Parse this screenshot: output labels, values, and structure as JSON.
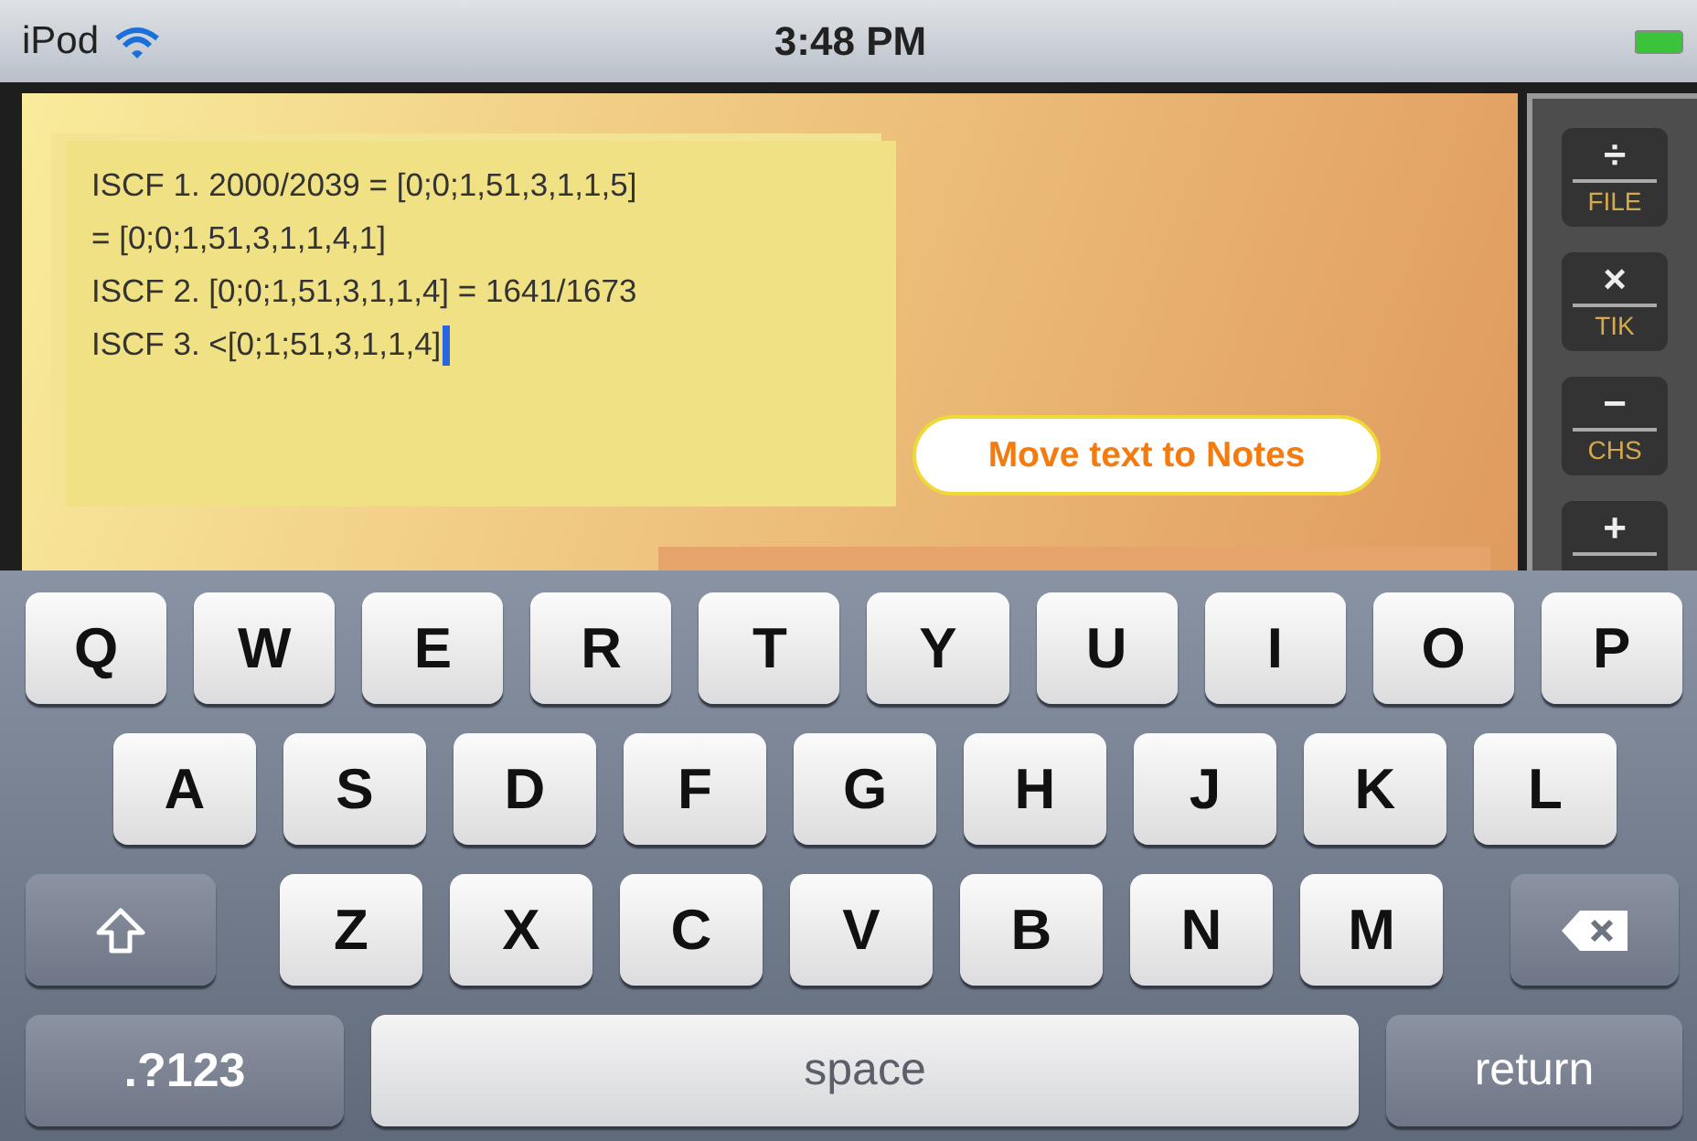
{
  "status_bar": {
    "carrier": "iPod",
    "time": "3:48 PM"
  },
  "note": {
    "lines": [
      "ISCF 1. 2000/2039 = [0;0;1,51,3,1,1,5]",
      "= [0;0;1,51,3,1,1,4,1]",
      "ISCF 2. [0;0;1,51,3,1,1,4] = 1641/1673",
      "ISCF 3. <[0;1;51,3,1,1,4]"
    ]
  },
  "move_button": {
    "label": "Move text to Notes"
  },
  "calc_keys": [
    {
      "symbol": "÷",
      "label": "FILE"
    },
    {
      "symbol": "×",
      "label": "TIK"
    },
    {
      "symbol": "−",
      "label": "CHS"
    },
    {
      "symbol": "+"
    }
  ],
  "keyboard": {
    "rows": [
      [
        {
          "kind": "letter",
          "label": "Q"
        },
        {
          "kind": "letter",
          "label": "W"
        },
        {
          "kind": "letter",
          "label": "E"
        },
        {
          "kind": "letter",
          "label": "R"
        },
        {
          "kind": "letter",
          "label": "T"
        },
        {
          "kind": "letter",
          "label": "Y"
        },
        {
          "kind": "letter",
          "label": "U"
        },
        {
          "kind": "letter",
          "label": "I"
        },
        {
          "kind": "letter",
          "label": "O"
        },
        {
          "kind": "letter",
          "label": "P"
        }
      ],
      [
        {
          "kind": "letter",
          "label": "A"
        },
        {
          "kind": "letter",
          "label": "S"
        },
        {
          "kind": "letter",
          "label": "D"
        },
        {
          "kind": "letter",
          "label": "F"
        },
        {
          "kind": "letter",
          "label": "G"
        },
        {
          "kind": "letter",
          "label": "H"
        },
        {
          "kind": "letter",
          "label": "J"
        },
        {
          "kind": "letter",
          "label": "K"
        },
        {
          "kind": "letter",
          "label": "L"
        }
      ],
      [
        {
          "kind": "shift"
        },
        {
          "kind": "letter",
          "label": "Z"
        },
        {
          "kind": "letter",
          "label": "X"
        },
        {
          "kind": "letter",
          "label": "C"
        },
        {
          "kind": "letter",
          "label": "V"
        },
        {
          "kind": "letter",
          "label": "B"
        },
        {
          "kind": "letter",
          "label": "N"
        },
        {
          "kind": "letter",
          "label": "M"
        },
        {
          "kind": "delete"
        }
      ]
    ],
    "bottom_keys": [
      {
        "kind": "mode",
        "label": ".?123"
      },
      {
        "kind": "space",
        "label": "space"
      },
      {
        "kind": "return",
        "label": "return"
      }
    ]
  }
}
